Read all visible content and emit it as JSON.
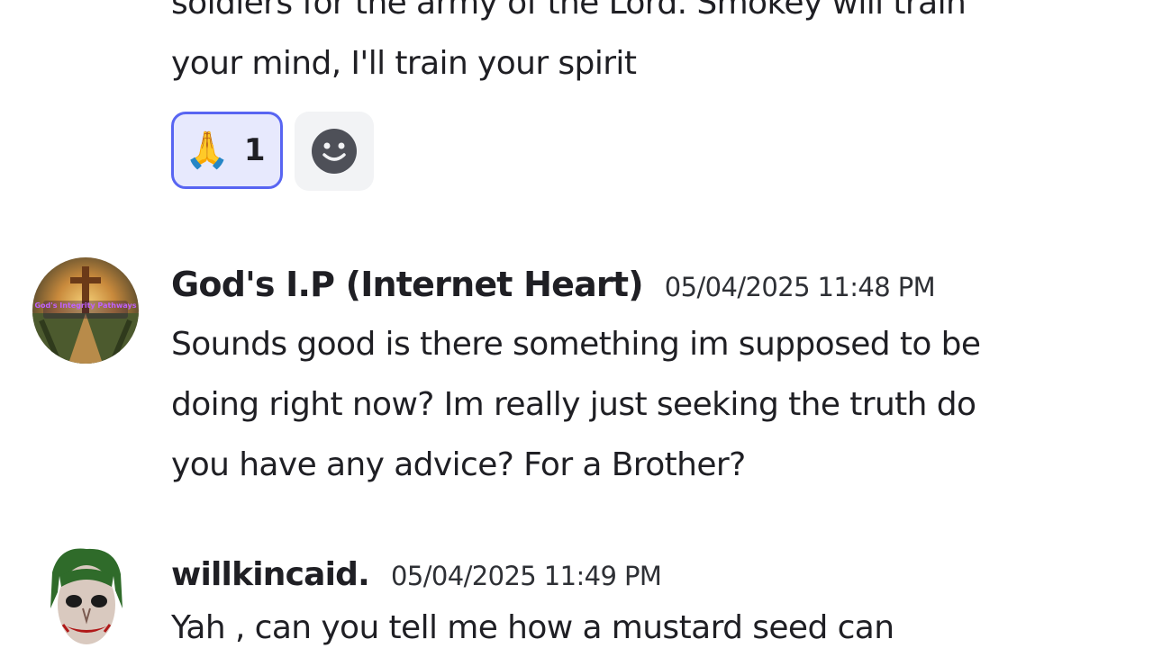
{
  "messages": [
    {
      "author": "",
      "lines": [
        "soldiers for the army of the Lord. Smokey will train",
        "your mind, I'll train your spirit"
      ],
      "reactions": [
        {
          "emoji": "🙏",
          "count": "1",
          "active": true
        }
      ]
    },
    {
      "author": "God's I.P (Internet Heart)",
      "timestamp": "05/04/2025 11:48 PM",
      "avatar_icon": "cross-sunset-avatar",
      "avatar_text": "God's Integrity Pathways",
      "lines": [
        "Sounds good is there something im supposed to be",
        "doing right now? Im really just seeking the truth do",
        "you have any advice? For a Brother?"
      ]
    },
    {
      "author": "willkincaid.",
      "timestamp": "05/04/2025 11:49 PM",
      "avatar_icon": "joker-avatar",
      "lines": [
        "Yah , can you tell me how a mustard seed can"
      ]
    }
  ],
  "colors": {
    "text": "#1f1f24",
    "reaction_border": "#5865f2",
    "reaction_bg": "#e7e9fd",
    "add_reaction_bg": "#f2f3f5"
  }
}
